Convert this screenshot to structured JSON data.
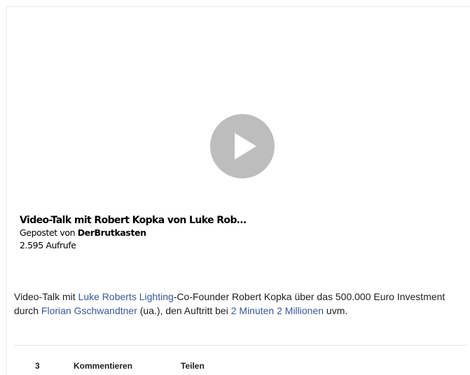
{
  "video": {
    "title": "Video-Talk mit Robert Kopka von Luke Rob…",
    "posted_by_prefix": "Gepostet von",
    "posted_by": "DerBrutkasten",
    "views": "2.595 Aufrufe",
    "play_icon": "play-icon"
  },
  "description": {
    "t1": "Video-Talk mit ",
    "link1": "Luke Roberts Lighting",
    "t2": "-Co-Founder Robert Kopka über das 500.000 Euro Investment durch ",
    "link2": "Florian Gschwandtner",
    "t3": " (ua.), den Auftritt bei ",
    "link3": "2 Minuten 2 Millionen",
    "t4": " uvm."
  },
  "actions": {
    "likes": "3",
    "comment": "Kommentieren",
    "share": "Teilen"
  },
  "colors": {
    "link": "#385898",
    "play_button": "#bdbdbd"
  }
}
